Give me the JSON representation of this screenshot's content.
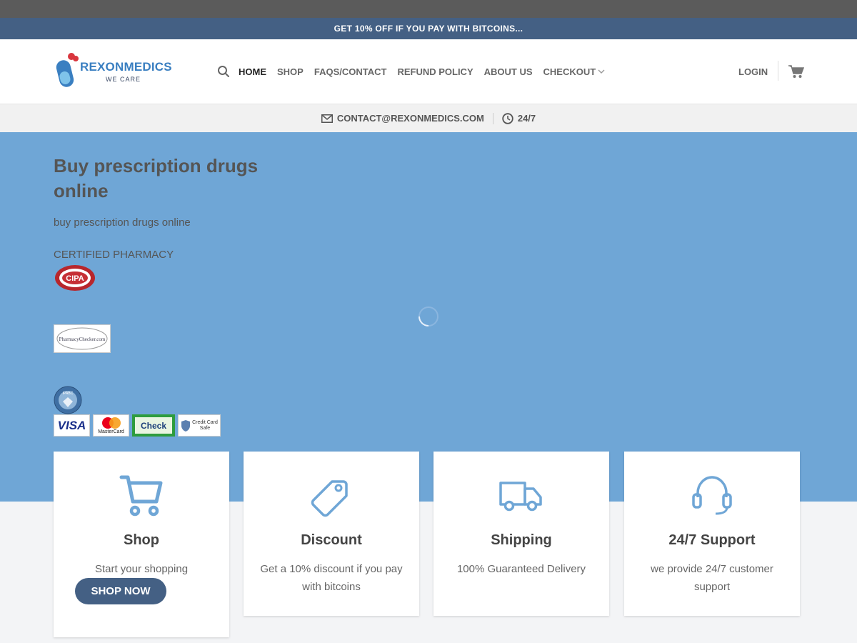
{
  "promo": {
    "text": "GET 10% OFF IF YOU PAY WITH BITCOINS..."
  },
  "brand": {
    "name": "REXONMEDICS",
    "tagline": "WE CARE",
    "colors": {
      "primary": "#446084",
      "hero": "#6fa6d6",
      "logo": "#3a7fc1",
      "accent": "#d9363e"
    }
  },
  "nav": {
    "search_icon": "search-icon",
    "items": [
      {
        "label": "HOME",
        "active": true
      },
      {
        "label": "SHOP"
      },
      {
        "label": "FAQS/CONTACT"
      },
      {
        "label": "REFUND POLICY"
      },
      {
        "label": "ABOUT US"
      },
      {
        "label": "CHECKOUT",
        "has_dropdown": true
      }
    ],
    "login": "LOGIN",
    "cart_icon": "cart-icon"
  },
  "contact": {
    "email": "CONTACT@REXONMEDICS.COM",
    "hours": "24/7"
  },
  "hero": {
    "title": "Buy prescription drugs online",
    "subtitle": "buy prescription drugs online",
    "certified": "CERTIFIED PHARMACY",
    "badges": {
      "cipa": "CIPA",
      "pharmacy_checker": "PharmacyChecker.com",
      "ipabc": "IPABC"
    },
    "payment": [
      "VISA",
      "MasterCard",
      "Check",
      "Credit Card Safe"
    ]
  },
  "cards": [
    {
      "title": "Shop",
      "text": "Start your shopping",
      "button": "SHOP NOW",
      "icon": "cart-icon"
    },
    {
      "title": "Discount",
      "text": "Get a 10% discount if you pay with bitcoins",
      "icon": "tag-icon"
    },
    {
      "title": "Shipping",
      "text": "100% Guaranteed Delivery",
      "icon": "truck-icon"
    },
    {
      "title": "24/7 Support",
      "text": "we provide  24/7 customer support",
      "icon": "headset-icon"
    }
  ]
}
